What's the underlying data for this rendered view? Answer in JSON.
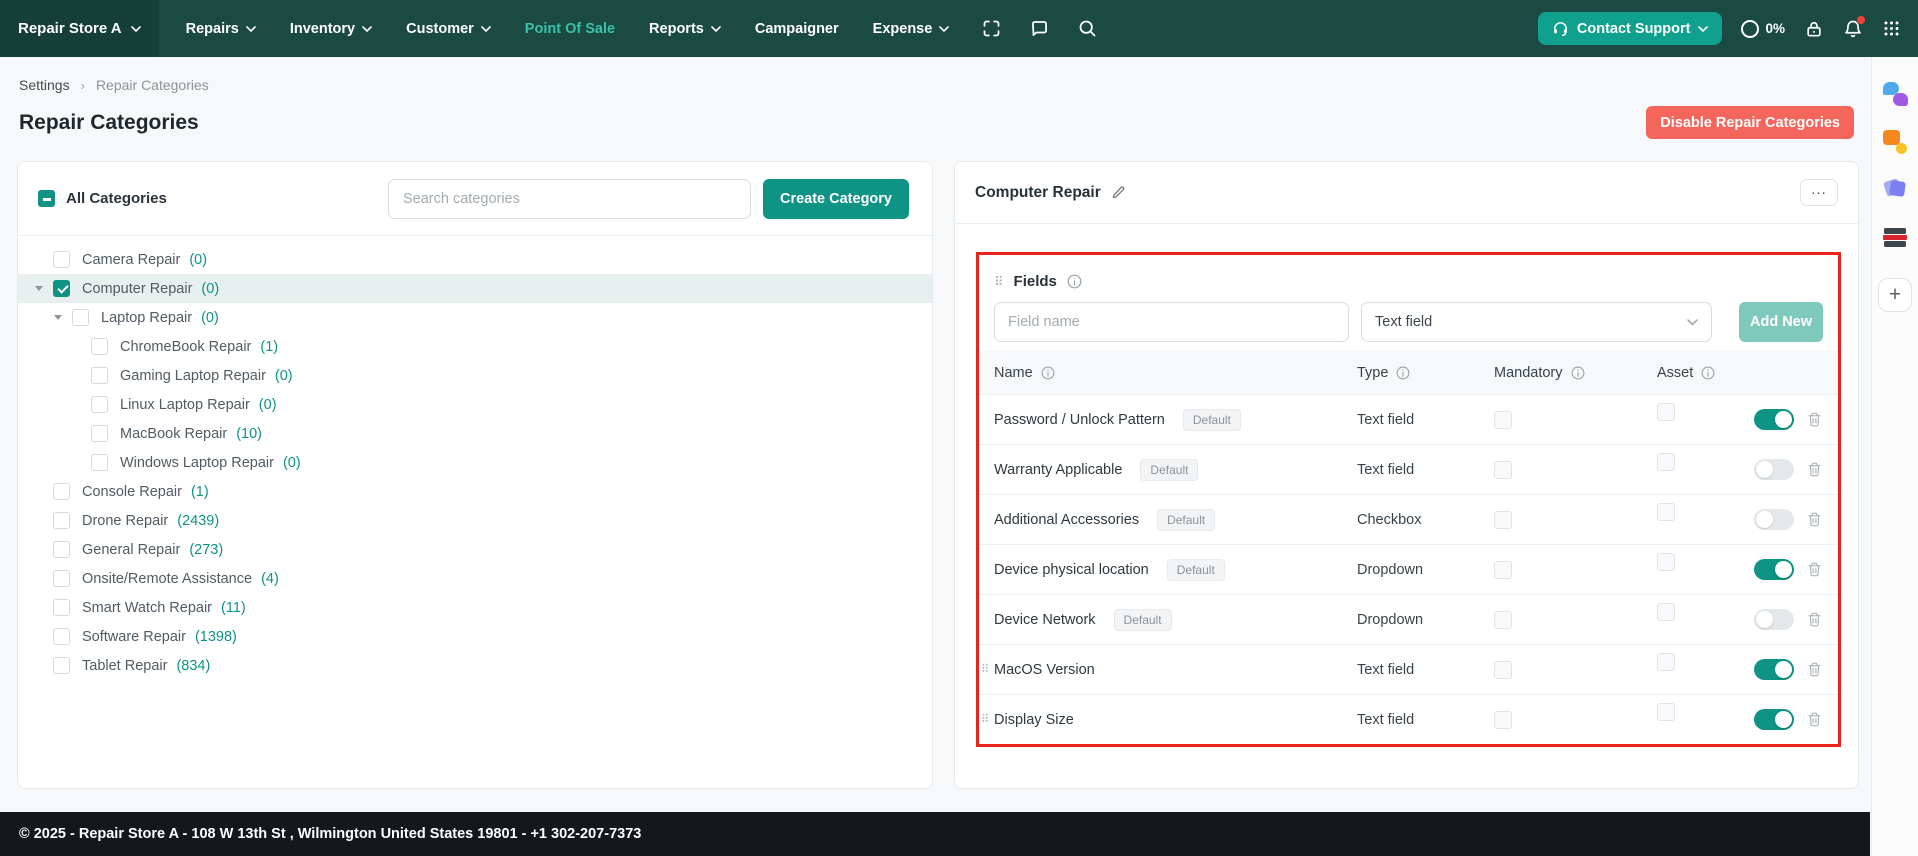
{
  "colors": {
    "nav-bg": "#1B4A43",
    "nav-bg-dark": "#153F38",
    "accent": "#0E9384",
    "accent-light": "#38C2A7",
    "accent-disabled": "#7FC9BC",
    "support": "#0FA18D",
    "danger": "#F4655C",
    "annotation": "#E8241B",
    "footer-bg": "#15181B"
  },
  "navbar": {
    "brand": "Repair Store A",
    "items": [
      {
        "label": "Repairs",
        "caret": true,
        "active": false
      },
      {
        "label": "Inventory",
        "caret": true,
        "active": false
      },
      {
        "label": "Customer",
        "caret": true,
        "active": false
      },
      {
        "label": "Point Of Sale",
        "caret": false,
        "active": true
      },
      {
        "label": "Reports",
        "caret": true,
        "active": false
      },
      {
        "label": "Campaigner",
        "caret": false,
        "active": false
      },
      {
        "label": "Expense",
        "caret": true,
        "active": false
      }
    ],
    "nav_icons": [
      "scan-icon",
      "chat-bubble-icon",
      "search-icon"
    ],
    "contact_support_label": "Contact Support",
    "progress_value": "0%",
    "right_icons": [
      "progress-ring-icon",
      "lock-icon",
      "bell-icon",
      "apps-grid-icon"
    ]
  },
  "breadcrumb": [
    "Settings",
    "Repair Categories"
  ],
  "page": {
    "title": "Repair Categories",
    "disable_button_label": "Disable Repair Categories"
  },
  "categories_panel": {
    "all_categories_label": "All Categories",
    "search_placeholder": "Search categories",
    "create_button_label": "Create Category",
    "tree": [
      {
        "label": "Camera Repair",
        "count": "(0)",
        "level": 0,
        "checked": false,
        "expanded": false,
        "selected": false
      },
      {
        "label": "Computer Repair",
        "count": "(0)",
        "level": 0,
        "checked": true,
        "expanded": true,
        "selected": true
      },
      {
        "label": "Laptop Repair",
        "count": "(0)",
        "level": 1,
        "checked": false,
        "expanded": true,
        "selected": false
      },
      {
        "label": "ChromeBook Repair",
        "count": "(1)",
        "level": 2,
        "checked": false,
        "expanded": false,
        "selected": false
      },
      {
        "label": "Gaming Laptop Repair",
        "count": "(0)",
        "level": 2,
        "checked": false,
        "expanded": false,
        "selected": false
      },
      {
        "label": "Linux Laptop Repair",
        "count": "(0)",
        "level": 2,
        "checked": false,
        "expanded": false,
        "selected": false
      },
      {
        "label": "MacBook Repair",
        "count": "(10)",
        "level": 2,
        "checked": false,
        "expanded": false,
        "selected": false
      },
      {
        "label": "Windows Laptop Repair",
        "count": "(0)",
        "level": 2,
        "checked": false,
        "expanded": false,
        "selected": false
      },
      {
        "label": "Console Repair",
        "count": "(1)",
        "level": 0,
        "checked": false,
        "expanded": false,
        "selected": false
      },
      {
        "label": "Drone Repair",
        "count": "(2439)",
        "level": 0,
        "checked": false,
        "expanded": false,
        "selected": false
      },
      {
        "label": "General Repair",
        "count": "(273)",
        "level": 0,
        "checked": false,
        "expanded": false,
        "selected": false
      },
      {
        "label": "Onsite/Remote Assistance",
        "count": "(4)",
        "level": 0,
        "checked": false,
        "expanded": false,
        "selected": false
      },
      {
        "label": "Smart Watch Repair",
        "count": "(11)",
        "level": 0,
        "checked": false,
        "expanded": false,
        "selected": false
      },
      {
        "label": "Software Repair",
        "count": "(1398)",
        "level": 0,
        "checked": false,
        "expanded": false,
        "selected": false
      },
      {
        "label": "Tablet Repair",
        "count": "(834)",
        "level": 0,
        "checked": false,
        "expanded": false,
        "selected": false
      }
    ]
  },
  "detail_panel": {
    "title": "Computer Repair",
    "fields": {
      "section_title": "Fields",
      "field_name_placeholder": "Field name",
      "type_selected": "Text field",
      "add_button_label": "Add New",
      "columns": [
        "Name",
        "Type",
        "Mandatory",
        "Asset"
      ],
      "rows": [
        {
          "name": "Password / Unlock Pattern",
          "badge": "Default",
          "type": "Text field",
          "mandatory": false,
          "asset": false,
          "enabled": true,
          "draggable": false
        },
        {
          "name": "Warranty Applicable",
          "badge": "Default",
          "type": "Text field",
          "mandatory": false,
          "asset": false,
          "enabled": false,
          "draggable": false
        },
        {
          "name": "Additional Accessories",
          "badge": "Default",
          "type": "Checkbox",
          "mandatory": false,
          "asset": false,
          "enabled": false,
          "draggable": false
        },
        {
          "name": "Device physical location",
          "badge": "Default",
          "type": "Dropdown",
          "mandatory": false,
          "asset": false,
          "enabled": true,
          "draggable": false
        },
        {
          "name": "Device Network",
          "badge": "Default",
          "type": "Dropdown",
          "mandatory": false,
          "asset": false,
          "enabled": false,
          "draggable": false
        },
        {
          "name": "MacOS Version",
          "badge": null,
          "type": "Text field",
          "mandatory": false,
          "asset": false,
          "enabled": true,
          "draggable": true
        },
        {
          "name": "Display Size",
          "badge": null,
          "type": "Text field",
          "mandatory": false,
          "asset": false,
          "enabled": true,
          "draggable": true
        }
      ]
    }
  },
  "side_strip": {
    "icons": [
      "chat-bubbles-extension-icon",
      "shapes-extension-icon",
      "cards-extension-icon",
      "stack-extension-icon",
      "add-extension-button"
    ]
  },
  "footer": {
    "text": "© 2025 - Repair Store A - 108 W 13th St , Wilmington United States 19801 - +1 302-207-7373"
  }
}
